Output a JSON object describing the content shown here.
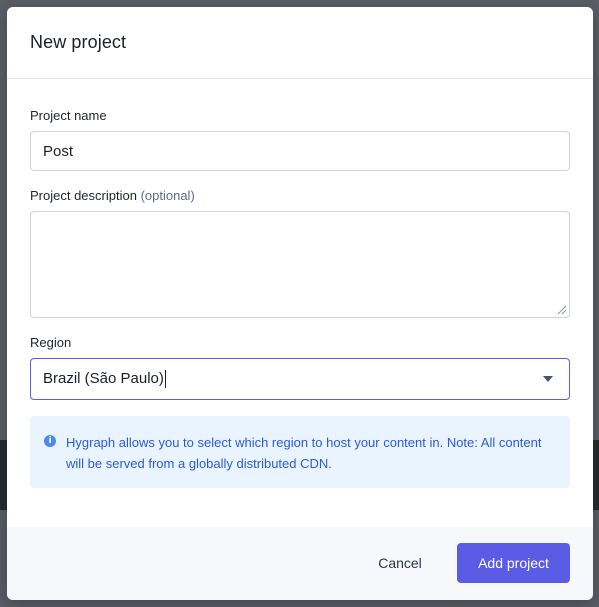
{
  "modal": {
    "title": "New project"
  },
  "form": {
    "project_name": {
      "label": "Project name",
      "value": "Post"
    },
    "project_description": {
      "label": "Project description",
      "optional_label": "(optional)",
      "value": ""
    },
    "region": {
      "label": "Region",
      "value": "Brazil (São Paulo)"
    }
  },
  "info": {
    "text": "Hygraph allows you to select which region to host your content in. Note: All content will be served from a globally distributed CDN.",
    "icon": "info-icon"
  },
  "footer": {
    "cancel_label": "Cancel",
    "add_label": "Add project"
  },
  "colors": {
    "accent": "#5b5ce6",
    "info_bg": "#eaf4ff",
    "info_text": "#2c5ad8"
  }
}
